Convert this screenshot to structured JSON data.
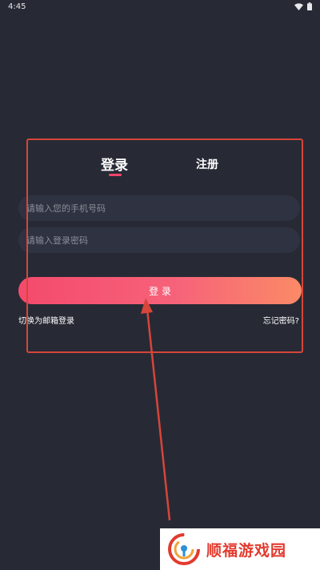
{
  "status_bar": {
    "time": "4:45",
    "icons": [
      "wifi-icon",
      "battery-icon"
    ]
  },
  "tabs": {
    "login": "登录",
    "register": "注册",
    "active": "login"
  },
  "form": {
    "phone_placeholder": "请输入您的手机号码",
    "password_placeholder": "请输入登录密码",
    "submit_label": "登 录",
    "switch_email_label": "切换为邮箱登录",
    "forgot_password_label": "忘记密码?"
  },
  "watermark": {
    "text": "顺福游戏园"
  },
  "colors": {
    "background": "#272a35",
    "field_background": "#2f3240",
    "accent_start": "#f44a6c",
    "accent_end": "#fb8a66",
    "annotation_red": "#d6453a"
  }
}
